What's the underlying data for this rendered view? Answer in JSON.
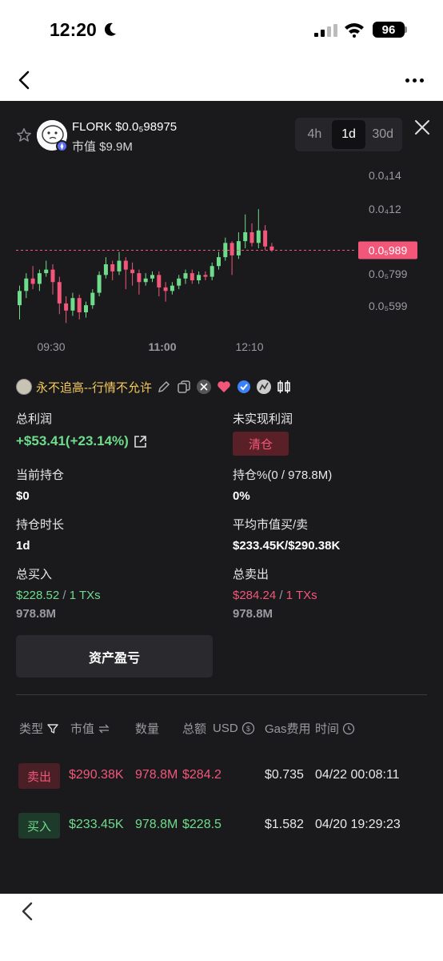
{
  "status_bar": {
    "time": "12:20",
    "battery": "96"
  },
  "token": {
    "name_price": "FLORK $0.0₅98975",
    "market_cap": "市值 $9.9M"
  },
  "timeframes": [
    {
      "label": "4h",
      "active": false
    },
    {
      "label": "1d",
      "active": true
    },
    {
      "label": "30d",
      "active": false
    }
  ],
  "chart_data": {
    "type": "candlestick",
    "y_ticks": [
      "0.0₄14",
      "0.0₄12",
      "0.0₅799",
      "0.0₅599"
    ],
    "current_price_label": "0.0₅989",
    "x_ticks": [
      "09:30",
      "11:00",
      "12:10"
    ],
    "candles": [
      [
        6.8e-06,
        7.6e-06,
        7.9e-06,
        6e-06
      ],
      [
        7.6e-06,
        8.3e-06,
        8.6e-06,
        7.2e-06
      ],
      [
        8.3e-06,
        8e-06,
        9e-06,
        7.7e-06
      ],
      [
        8e-06,
        8.6e-06,
        8.8e-06,
        7.6e-06
      ],
      [
        8.6e-06,
        8.8e-06,
        9.3e-06,
        8.4e-06
      ],
      [
        8.8e-06,
        8.1e-06,
        9.1e-06,
        7.4e-06
      ],
      [
        8.1e-06,
        6.9e-06,
        8.4e-06,
        6.3e-06
      ],
      [
        6.9e-06,
        6.5e-06,
        7.3e-06,
        5.8e-06
      ],
      [
        6.5e-06,
        7.2e-06,
        7.5e-06,
        6.2e-06
      ],
      [
        7.2e-06,
        6.4e-06,
        7.4e-06,
        6e-06
      ],
      [
        6.4e-06,
        6.8e-06,
        7e-06,
        6.1e-06
      ],
      [
        6.8e-06,
        7.5e-06,
        7.7e-06,
        6.6e-06
      ],
      [
        7.5e-06,
        8.5e-06,
        8.7e-06,
        7.3e-06
      ],
      [
        8.5e-06,
        9.1e-06,
        9.5e-06,
        8.3e-06
      ],
      [
        9.1e-06,
        8.7e-06,
        9.3e-06,
        8.2e-06
      ],
      [
        8.7e-06,
        9.3e-06,
        9.8e-06,
        8.5e-06
      ],
      [
        9.3e-06,
        8.8e-06,
        9.5e-06,
        7.7e-06
      ],
      [
        8.8e-06,
        8.6e-06,
        9.2e-06,
        7.9e-06
      ],
      [
        8.6e-06,
        8.1e-06,
        8.8e-06,
        7.4e-06
      ],
      [
        8.1e-06,
        8.3e-06,
        8.6e-06,
        7.9e-06
      ],
      [
        8.3e-06,
        8.5e-06,
        8.7e-06,
        8.1e-06
      ],
      [
        8.5e-06,
        7.8e-06,
        8.7e-06,
        7.3e-06
      ],
      [
        7.8e-06,
        7.6e-06,
        8.1e-06,
        7e-06
      ],
      [
        7.6e-06,
        7.9e-06,
        8.1e-06,
        7.4e-06
      ],
      [
        7.9e-06,
        8.3e-06,
        8.5e-06,
        7.7e-06
      ],
      [
        8.3e-06,
        8.6e-06,
        8.8e-06,
        8e-06
      ],
      [
        8.6e-06,
        8.2e-06,
        8.8e-06,
        8e-06
      ],
      [
        8.2e-06,
        8.5e-06,
        8.7e-06,
        8e-06
      ],
      [
        8.5e-06,
        8.4e-06,
        8.7e-06,
        8.2e-06
      ],
      [
        8.4e-06,
        9e-06,
        9.2e-06,
        8.2e-06
      ],
      [
        9e-06,
        9.5e-06,
        9.8e-06,
        8.8e-06
      ],
      [
        9.5e-06,
        1.03e-05,
        1.06e-05,
        9.3e-06
      ],
      [
        1.03e-05,
        9.6e-06,
        1.04e-05,
        8.5e-06
      ],
      [
        9.6e-06,
        1.04e-05,
        1.09e-05,
        9.4e-06
      ],
      [
        1.04e-05,
        1.09e-05,
        1.19e-05,
        1e-05
      ],
      [
        1.09e-05,
        1.03e-05,
        1.14e-05,
        1.01e-05
      ],
      [
        1.03e-05,
        1.1e-05,
        1.22e-05,
        1e-05
      ],
      [
        1.1e-05,
        1.01e-05,
        1.13e-05,
        9.9e-06
      ],
      [
        1.01e-05,
        9.89e-06,
        1.03e-05,
        9.8e-06
      ]
    ]
  },
  "trader": {
    "name": "永不追高--行情不允许"
  },
  "stats": {
    "total_profit_label": "总利润",
    "total_profit_value": "+$53.41(+23.14%)",
    "unrealized_label": "未实现利润",
    "clear_button": "清仓",
    "current_holding_label": "当前持仓",
    "current_holding_value": "$0",
    "holding_pct_label": "持仓%(0 / 978.8M)",
    "holding_pct_value": "0%",
    "holding_duration_label": "持仓时长",
    "holding_duration_value": "1d",
    "avg_mcap_label": "平均市值买/卖",
    "avg_mcap_value": "$233.45K/$290.38K",
    "total_buy_label": "总买入",
    "total_buy_amount": "$228.52",
    "total_buy_sep": "/",
    "total_buy_txs": "1 TXs",
    "total_buy_qty": "978.8M",
    "total_sell_label": "总卖出",
    "total_sell_amount": "$284.24",
    "total_sell_sep": "/",
    "total_sell_txs": "1 TXs",
    "total_sell_qty": "978.8M"
  },
  "asset_pnl_button": "资产盈亏",
  "table": {
    "headers": {
      "type": "类型",
      "mcap": "市值",
      "qty": "数量",
      "total": "总额",
      "usd": "USD",
      "gas": "Gas费用",
      "time": "时间"
    },
    "rows": [
      {
        "type": "卖出",
        "side": "sell",
        "mcap": "$290.38K",
        "qty": "978.8M",
        "total": "$284.2",
        "gas": "$0.735",
        "time": "04/22 00:08:11"
      },
      {
        "type": "买入",
        "side": "buy",
        "mcap": "$233.45K",
        "qty": "978.8M",
        "total": "$228.5",
        "gas": "$1.582",
        "time": "04/20 19:29:23"
      }
    ]
  },
  "colors": {
    "up": "#6fdc8c",
    "down": "#f2577a",
    "panel": "#1a1a1d",
    "trader_name": "#f4c95d"
  }
}
